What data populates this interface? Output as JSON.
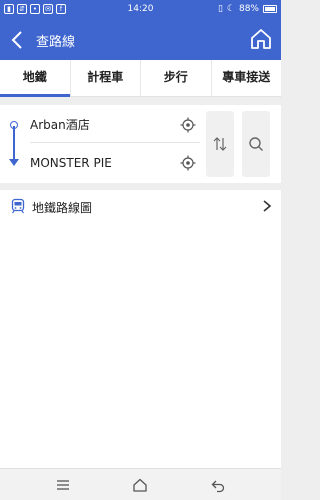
{
  "status_bar": {
    "time": "14:20",
    "battery": "88%"
  },
  "app_bar": {
    "title": "查路線",
    "icons": [
      "back-arrow-icon",
      "home-icon"
    ]
  },
  "tabs": [
    {
      "label": "地鐵",
      "active": true
    },
    {
      "label": "計程車",
      "active": false
    },
    {
      "label": "步行",
      "active": false
    },
    {
      "label": "專車接送",
      "active": false
    }
  ],
  "route": {
    "origin": "Arban酒店",
    "destination": "MONSTER PIE"
  },
  "metro_map": {
    "label": "地鐵路線圖"
  },
  "colors": {
    "primary": "#3f66cf",
    "background": "#eeeeee"
  }
}
